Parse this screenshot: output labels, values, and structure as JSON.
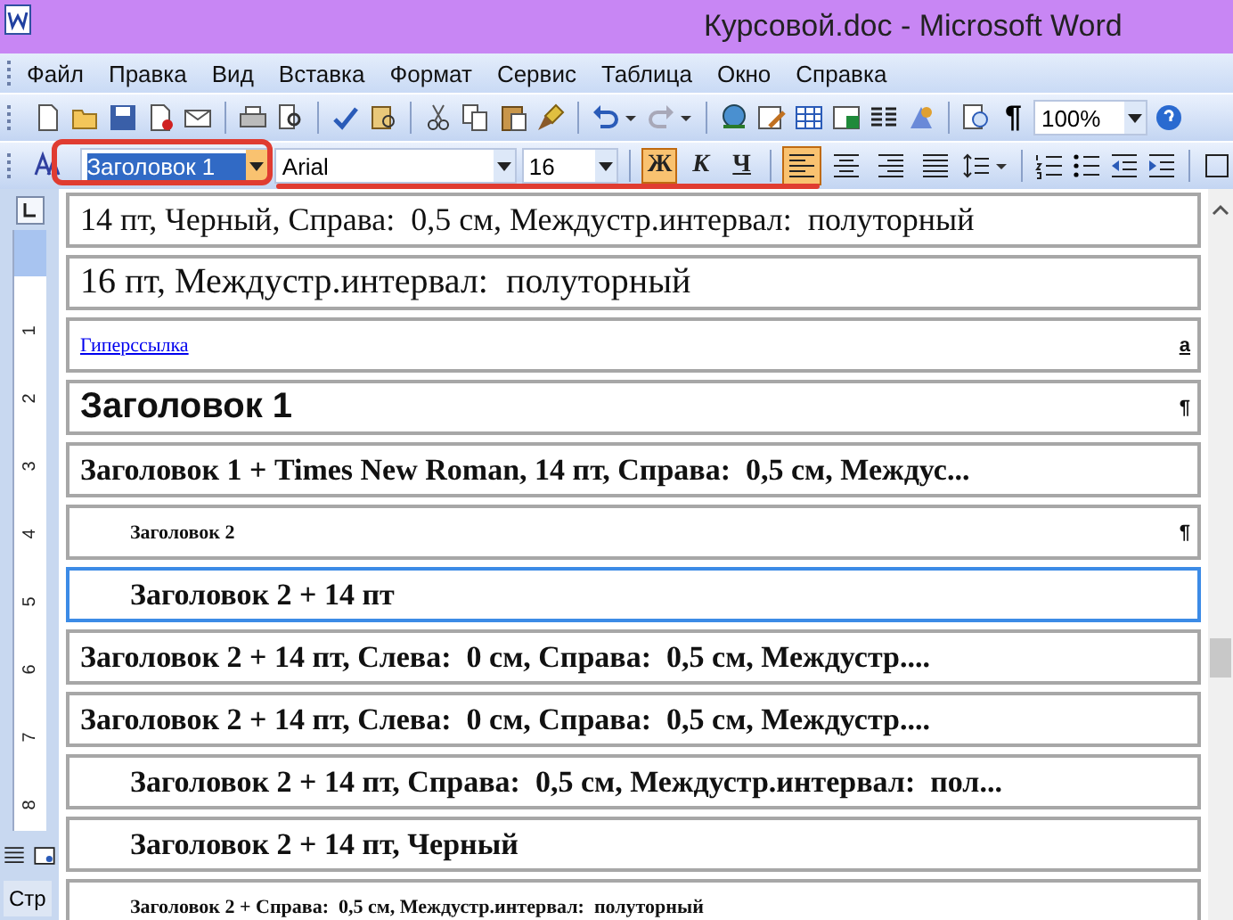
{
  "window": {
    "title": "Курсовой.doc - Microsoft Word"
  },
  "menu": [
    "Файл",
    "Правка",
    "Вид",
    "Вставка",
    "Формат",
    "Сервис",
    "Таблица",
    "Окно",
    "Справка"
  ],
  "standard_toolbar": {
    "pilcrow": "¶",
    "zoom": "100%"
  },
  "formatting_toolbar": {
    "style": "Заголовок 1",
    "style_selected": true,
    "font": "Arial",
    "size": "16",
    "buttons": [
      {
        "label": "Ж",
        "on": true
      },
      {
        "label": "К",
        "on": false
      },
      {
        "label": "Ч",
        "on": false
      }
    ],
    "alignment": [
      {
        "selected": true
      },
      {
        "selected": false
      },
      {
        "selected": false
      },
      {
        "selected": false
      }
    ]
  },
  "ruler": [
    "1",
    "2",
    "3",
    "4",
    "5",
    "6",
    "7",
    "8"
  ],
  "style_list": [
    {
      "kind": "large",
      "text": "14 пт, Черный, Справа:  0,5 см, Междустр.интервал:  полуторный",
      "selected": false
    },
    {
      "kind": "larger",
      "text": "16 пт, Междустр.интервал:  полуторный",
      "selected": false
    },
    {
      "kind": "link",
      "text": "Гиперссылка",
      "mark": "a",
      "selected": false
    },
    {
      "kind": "heading1",
      "text": "Заголовок 1",
      "mark": "¶",
      "selected": false
    },
    {
      "kind": "serifbold",
      "text": "Заголовок 1 + Times New Roman, 14 пт, Справа:  0,5 см, Междус...",
      "selected": false
    },
    {
      "kind": "heading2",
      "text": "Заголовок 2",
      "mark": "¶",
      "selected": false
    },
    {
      "kind": "indented",
      "text": "Заголовок 2 + 14 пт",
      "selected": true
    },
    {
      "kind": "serifbold",
      "text": "Заголовок 2 + 14 пт, Слева:  0 см, Справа:  0,5 см, Междустр....",
      "selected": false
    },
    {
      "kind": "serifbold",
      "text": "Заголовок 2 + 14 пт, Слева:  0 см, Справа:  0,5 см, Междустр....",
      "selected": false
    },
    {
      "kind": "indented",
      "text": "Заголовок 2 + 14 пт, Справа:  0,5 см, Междустр.интервал:  пол...",
      "selected": false
    },
    {
      "kind": "indented",
      "text": "Заголовок 2 + 14 пт, Черный",
      "selected": false
    },
    {
      "kind": "heading2",
      "text": "Заголовок 2 + Справа:  0,5 см, Междустр.интервал:  полуторный",
      "selected": false
    }
  ],
  "status_bar": {
    "page": "Стр"
  }
}
